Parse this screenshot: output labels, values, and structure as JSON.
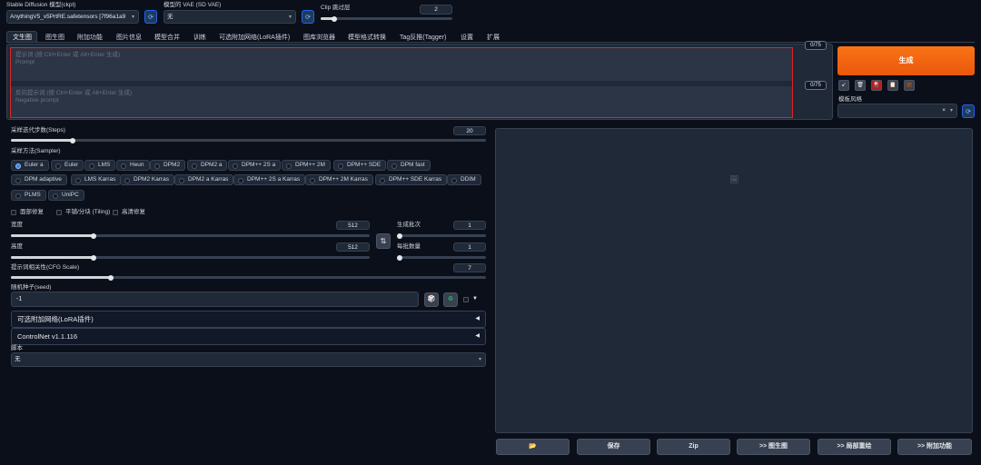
{
  "top": {
    "model_label": "Stable Diffusion 模型(ckpt)",
    "model_value": "AnythingV5_v5PrtRE.safetensors [7f96a1a9",
    "vae_label": "模型的 VAE (SD VAE)",
    "vae_value": "无",
    "clip_label": "Clip 跳过层",
    "clip_value": "2",
    "clip_fraction": 0.1
  },
  "tabs": [
    "文生图",
    "图生图",
    "附加功能",
    "图片信息",
    "模型合并",
    "训练",
    "可选附加网络(LoRA插件)",
    "图库浏览器",
    "模型格式转换",
    "Tag反推(Tagger)",
    "设置",
    "扩展"
  ],
  "prompt": {
    "placeholder_line1": "提示词 (按 Ctrl+Enter 或 Alt+Enter 生成)",
    "placeholder_line2": "Prompt",
    "counter": "0/75"
  },
  "negative": {
    "placeholder_line1": "反向提示词 (按 Ctrl+Enter 或 Alt+Enter 生成)",
    "placeholder_line2": "Negative prompt",
    "counter": "0/75"
  },
  "generate_label": "生成",
  "style": {
    "label": "模板风格",
    "clear": "×",
    "caret": "▾"
  },
  "tools": [
    "↙",
    "🗑",
    "🎴",
    "📋",
    "💼"
  ],
  "steps": {
    "label": "采样迭代步数(Steps)",
    "value": "20",
    "fraction": 0.13
  },
  "sampler": {
    "label": "采样方法(Sampler)",
    "selected": "Euler a",
    "options": [
      "Euler a",
      "Euler",
      "LMS",
      "Heun",
      "DPM2",
      "DPM2 a",
      "DPM++ 2S a",
      "DPM++ 2M",
      "DPM++ SDE",
      "DPM fast",
      "DPM adaptive",
      "LMS Karras",
      "DPM2 Karras",
      "DPM2 a Karras",
      "DPM++ 2S a Karras",
      "DPM++ 2M Karras",
      "DPM++ SDE Karras",
      "DDIM",
      "PLMS",
      "UniPC"
    ]
  },
  "checks": [
    "面部修复",
    "平铺/分块 (Tiling)",
    "高清修复"
  ],
  "width": {
    "label": "宽度",
    "value": "512",
    "fraction": 0.23
  },
  "height": {
    "label": "高度",
    "value": "512",
    "fraction": 0.23
  },
  "swap_icon": "⇅",
  "batch_count": {
    "label": "生成批次",
    "value": "1",
    "fraction": 0.0
  },
  "batch_size": {
    "label": "每批数量",
    "value": "1",
    "fraction": 0.0
  },
  "cfg": {
    "label": "提示词相关性(CFG Scale)",
    "value": "7",
    "fraction": 0.21
  },
  "seed": {
    "label": "随机种子(seed)",
    "value": "-1",
    "dice": "🎲",
    "recycle": "♻",
    "extra_arrow": "▼"
  },
  "accordions": [
    {
      "label": "可选附加网络(LoRA插件)",
      "arrow": "◀"
    },
    {
      "label": "ControlNet v1.1.116",
      "arrow": "◀"
    }
  ],
  "script": {
    "label": "脚本",
    "value": "无",
    "caret": "▾"
  },
  "output": {
    "image_icon": "🖼",
    "buttons": [
      "📂",
      "保存",
      "Zip",
      ">> 图生图",
      ">> 局部重绘",
      ">> 附加功能"
    ]
  },
  "colors": {
    "accent": "#f97316",
    "background": "#0b0f19",
    "panel": "#1f2937",
    "prompt_border": "#dc2626"
  }
}
